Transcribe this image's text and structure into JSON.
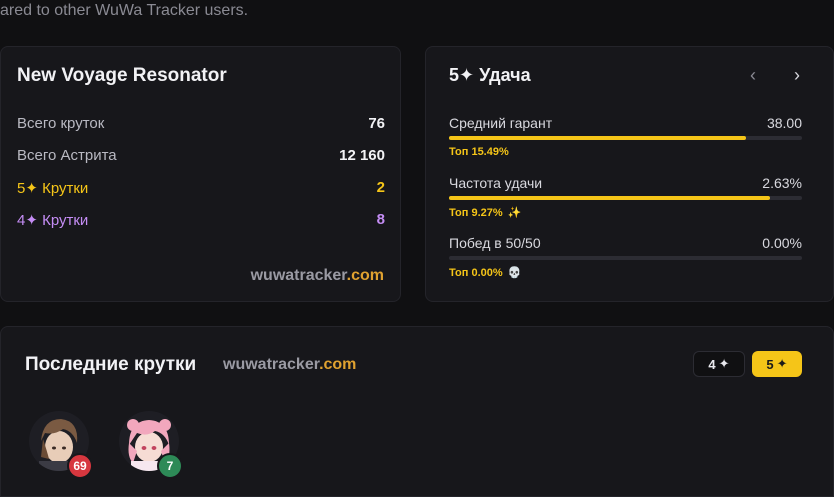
{
  "top_text": "ared to other WuWa Tracker users.",
  "resonator_card": {
    "title": "New Voyage Resonator",
    "rows": [
      {
        "label": "Всего круток",
        "value": "76"
      },
      {
        "label": "Всего Астрита",
        "value": "12 160"
      },
      {
        "label": "5✦ Крутки",
        "value": "2"
      },
      {
        "label": "4✦ Крутки",
        "value": "8"
      }
    ],
    "brand_main": "wuwatracker",
    "brand_tld": ".com"
  },
  "luck_card": {
    "title": "5✦ Удача",
    "prev_icon": "‹",
    "next_icon": "›",
    "metrics": [
      {
        "label": "Средний гарант",
        "value": "38.00",
        "rank": "Топ 15.49%",
        "emoji": "",
        "fill": 0.84
      },
      {
        "label": "Частота удачи",
        "value": "2.63%",
        "rank": "Топ 9.27%",
        "emoji": "✨",
        "fill": 0.91
      },
      {
        "label": "Побед в 50/50",
        "value": "0.00%",
        "rank": "Топ 0.00%",
        "emoji": "💀",
        "fill": 0.0
      }
    ]
  },
  "recent_pulls": {
    "title": "Последние крутки",
    "brand_main": "wuwatracker",
    "brand_tld": ".com",
    "filters": [
      {
        "label": "4",
        "star": "✦",
        "active": false
      },
      {
        "label": "5",
        "star": "✦",
        "active": true
      }
    ],
    "avatars": [
      {
        "name_icon": "brown-haired-male-avatar",
        "count": "69",
        "badge_color": "#d7373f"
      },
      {
        "name_icon": "pink-haired-female-avatar",
        "count": "7",
        "badge_color": "#2d8a57"
      }
    ]
  },
  "colors": {
    "accent_gold": "#f5c518",
    "accent_purple": "#c58df5",
    "brand_orange": "#e0a230"
  }
}
